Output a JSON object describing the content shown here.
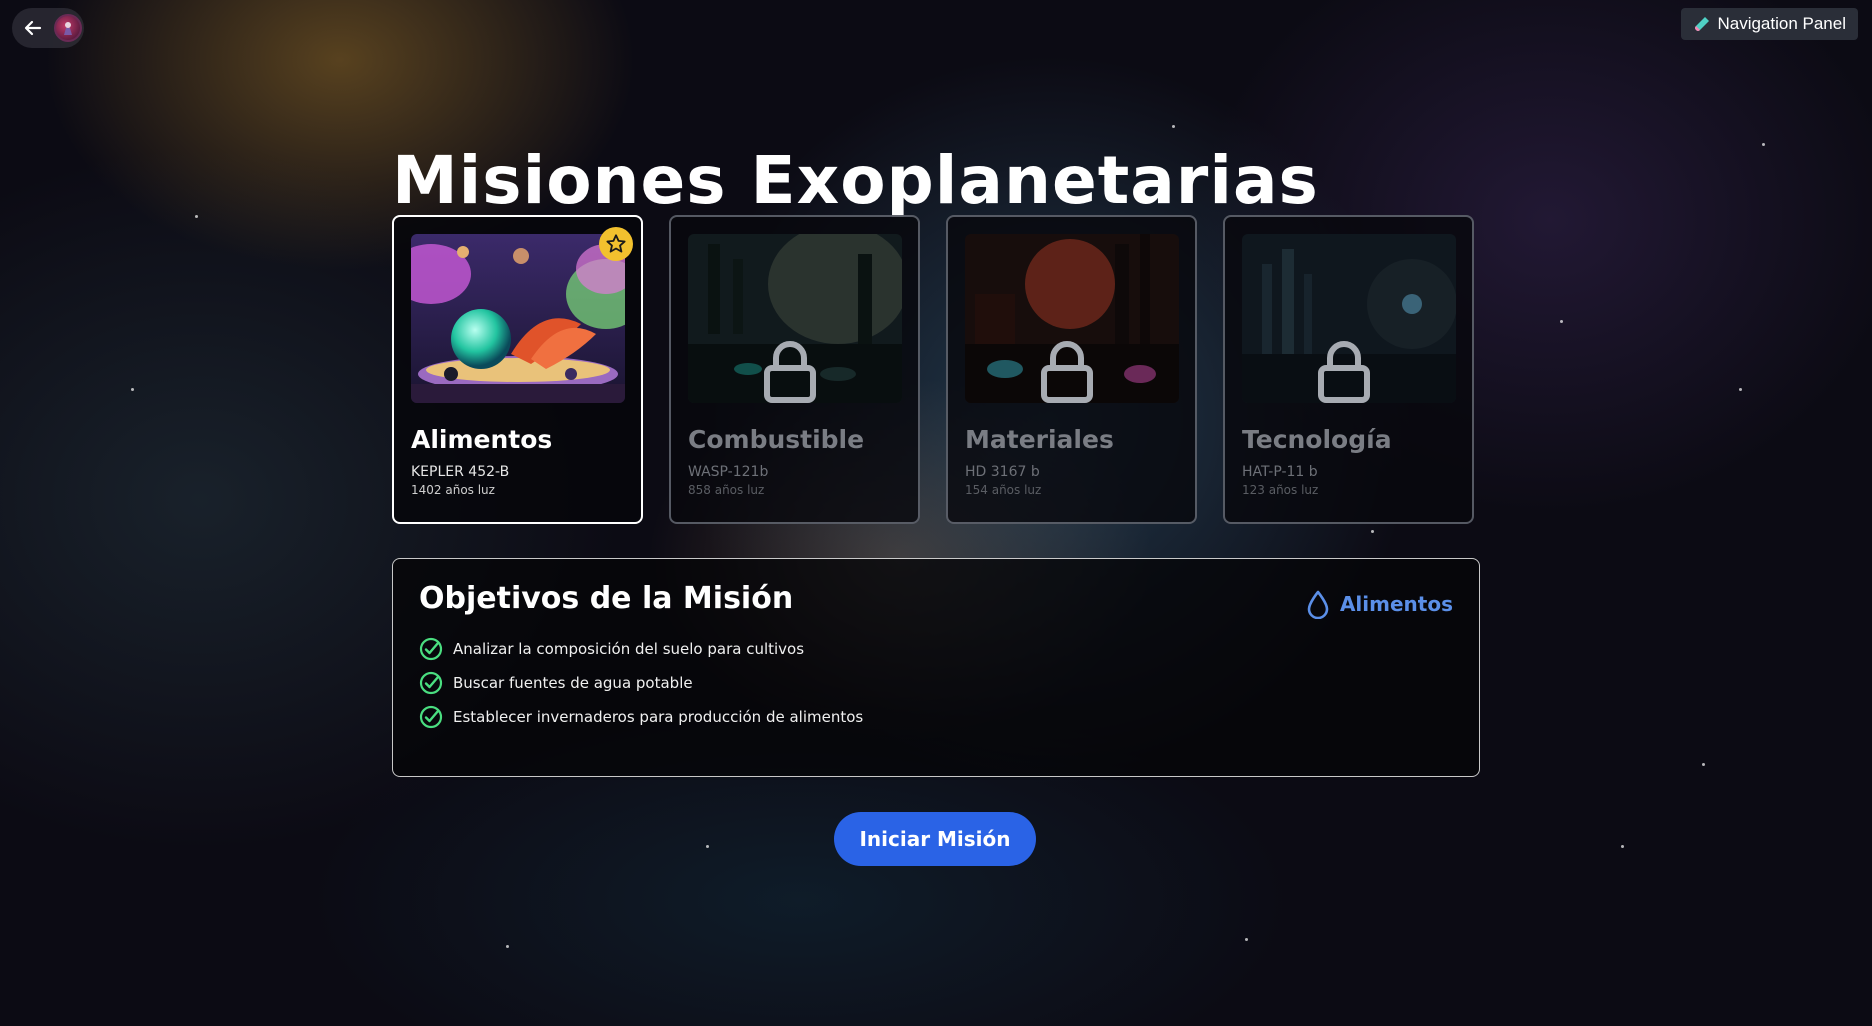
{
  "top_left": {
    "back_icon": "arrow-left-icon",
    "avatar_icon": "astronaut-avatar"
  },
  "nav_panel": {
    "label": "Navigation Panel",
    "icon": "test-tube-icon"
  },
  "title": "Misiones Exoplanetarias",
  "missions": [
    {
      "name": "Alimentos",
      "planet": "KEPLER 452-B",
      "distance": "1402 años luz",
      "locked": false,
      "selected": true
    },
    {
      "name": "Combustible",
      "planet": "WASP-121b",
      "distance": "858 años luz",
      "locked": true,
      "selected": false
    },
    {
      "name": "Materiales",
      "planet": "HD 3167 b",
      "distance": "154 años luz",
      "locked": true,
      "selected": false
    },
    {
      "name": "Tecnología",
      "planet": "HAT-P-11 b",
      "distance": "123 años luz",
      "locked": true,
      "selected": false
    }
  ],
  "objectives": {
    "title": "Objetivos de la Misión",
    "tag": "Alimentos",
    "tag_icon": "water-drop-icon",
    "items": [
      "Analizar la composición del suelo para cultivos",
      "Buscar fuentes de agua potable",
      "Establecer invernaderos para producción de alimentos"
    ]
  },
  "start_button": "Iniciar Misión",
  "colors": {
    "accent": "#2a63e6",
    "tag": "#5b8fe8",
    "check": "#4ade80",
    "badge": "#f2c12e"
  }
}
